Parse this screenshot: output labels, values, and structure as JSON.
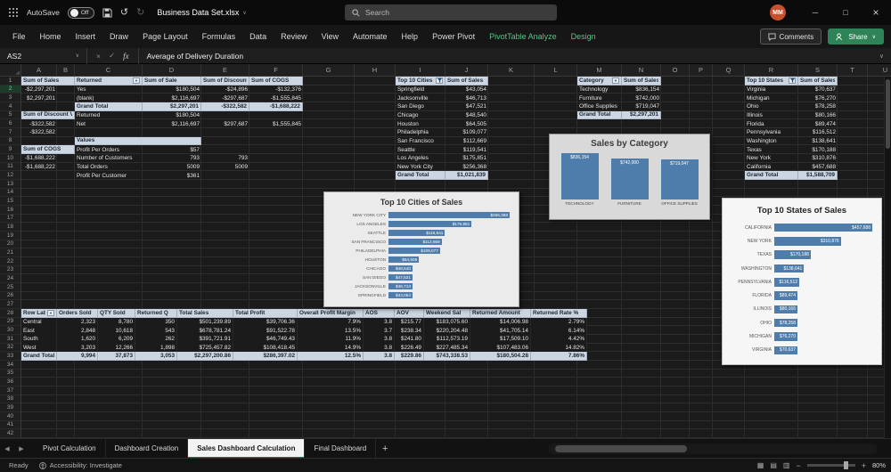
{
  "titlebar": {
    "autosave_label": "AutoSave",
    "autosave_state": "Off",
    "filename": "Business Data Set.xlsx",
    "search_placeholder": "Search",
    "avatar_initials": "MM"
  },
  "ribbon": {
    "tabs": [
      {
        "label": "File"
      },
      {
        "label": "Home"
      },
      {
        "label": "Insert"
      },
      {
        "label": "Draw"
      },
      {
        "label": "Page Layout"
      },
      {
        "label": "Formulas"
      },
      {
        "label": "Data"
      },
      {
        "label": "Review"
      },
      {
        "label": "View"
      },
      {
        "label": "Automate"
      },
      {
        "label": "Help"
      },
      {
        "label": "Power Pivot"
      },
      {
        "label": "PivotTable Analyze",
        "accent": true
      },
      {
        "label": "Design",
        "accent": true
      }
    ],
    "comments_label": "Comments",
    "share_label": "Share"
  },
  "formula_bar": {
    "name_box": "AS2",
    "fx_label": "fx",
    "formula": "Average of Delivery Duration"
  },
  "sheet": {
    "row_count": 42,
    "active_row": 2,
    "blocks": [
      {
        "name": "sales-summary-pivot",
        "col": "A",
        "row": 1,
        "widths": [
          40,
          20
        ],
        "aligns": [
          "r",
          "r"
        ],
        "rows": [
          {
            "r": 1,
            "cls": "hdr",
            "spans": [
              2
            ],
            "cells": [
              "Sum of Sales"
            ]
          },
          {
            "r": 2,
            "cells": [
              "-$2,297,201"
            ]
          },
          {
            "r": 3,
            "cells": [
              "$2,297,201"
            ]
          },
          {
            "r": 5,
            "cls": "hdr",
            "spans": [
              2
            ],
            "cells": [
              "Sum of Discount Value"
            ]
          },
          {
            "r": 6,
            "cells": [
              "-$322,582"
            ]
          },
          {
            "r": 7,
            "cells": [
              "-$322,582"
            ]
          },
          {
            "r": 9,
            "cls": "hdr",
            "spans": [
              2
            ],
            "cells": [
              "Sum of COGS"
            ]
          },
          {
            "r": 10,
            "cells": [
              "-$1,688,222"
            ]
          },
          {
            "r": 11,
            "cells": [
              "-$1,688,222"
            ]
          }
        ]
      },
      {
        "name": "returned-pivot",
        "col": "C",
        "row": 1,
        "widths": [
          76,
          66,
          54,
          60
        ],
        "aligns": [
          "l",
          "r",
          "r",
          "r"
        ],
        "rows": [
          {
            "r": 1,
            "cls": "hdr",
            "icons": {
              "0": "dd"
            },
            "cells": [
              "Returned",
              "Sum of Sale",
              "Sum of Discount Value",
              "Sum of COGS"
            ]
          },
          {
            "r": 2,
            "cells": [
              "Yes",
              "$180,504",
              "-$24,896",
              "-$132,376"
            ]
          },
          {
            "r": 3,
            "cells": [
              "(blank)",
              "$2,116,697",
              "-$297,687",
              "-$1,555,845"
            ]
          },
          {
            "r": 4,
            "cls": "tot",
            "cells": [
              "Grand Total",
              "$2,297,201",
              "-$322,582",
              "-$1,688,222"
            ]
          },
          {
            "r": 5,
            "cells": [
              "Returned",
              "$180,504",
              "",
              ""
            ]
          },
          {
            "r": 6,
            "cells": [
              "Net",
              "$2,116,697",
              "$297,687",
              "$1,555,845"
            ]
          }
        ]
      },
      {
        "name": "values-block",
        "col": "C",
        "row": 8,
        "widths": [
          76,
          66,
          54
        ],
        "aligns": [
          "l",
          "r",
          "r"
        ],
        "rows": [
          {
            "r": 8,
            "cls": "hdr",
            "spans": [
              2
            ],
            "cells": [
              "Values"
            ]
          },
          {
            "r": 9,
            "cells": [
              "Profit Per Orders",
              "$57",
              ""
            ]
          },
          {
            "r": 10,
            "cells": [
              "Number of Customers",
              "793",
              "793"
            ]
          },
          {
            "r": 11,
            "cells": [
              "Total Orders",
              "5009",
              "5009"
            ]
          },
          {
            "r": 12,
            "cells": [
              "Profit Per Customer",
              "$361",
              ""
            ]
          }
        ]
      },
      {
        "name": "top-cities-pivot",
        "col": "I",
        "row": 1,
        "widths": [
          56,
          48
        ],
        "aligns": [
          "l",
          "r"
        ],
        "rows": [
          {
            "r": 1,
            "cls": "hdr",
            "icons": {
              "0": "fl"
            },
            "cells": [
              "Top 10 Cities",
              "Sum of Sales"
            ]
          },
          {
            "r": 2,
            "cells": [
              "Springfield",
              "$43,054"
            ]
          },
          {
            "r": 3,
            "cells": [
              "Jacksonville",
              "$46,713"
            ]
          },
          {
            "r": 4,
            "cells": [
              "San Diego",
              "$47,521"
            ]
          },
          {
            "r": 5,
            "cells": [
              "Chicago",
              "$48,540"
            ]
          },
          {
            "r": 6,
            "cells": [
              "Houston",
              "$64,505"
            ]
          },
          {
            "r": 7,
            "cells": [
              "Philadelphia",
              "$109,077"
            ]
          },
          {
            "r": 8,
            "cells": [
              "San Francisco",
              "$112,669"
            ]
          },
          {
            "r": 9,
            "cells": [
              "Seattle",
              "$119,541"
            ]
          },
          {
            "r": 10,
            "cells": [
              "Los Angeles",
              "$175,851"
            ]
          },
          {
            "r": 11,
            "cells": [
              "New York City",
              "$256,368"
            ]
          },
          {
            "r": 12,
            "cls": "tot",
            "cells": [
              "Grand Total",
              "$1,021,839"
            ]
          }
        ]
      },
      {
        "name": "category-pivot",
        "col": "M",
        "row": 1,
        "widths": [
          50,
          44
        ],
        "aligns": [
          "l",
          "r"
        ],
        "rows": [
          {
            "r": 1,
            "cls": "hdr",
            "icons": {
              "0": "dd"
            },
            "cells": [
              "Category",
              "Sum of Sales"
            ]
          },
          {
            "r": 2,
            "cells": [
              "Technology",
              "$836,154"
            ]
          },
          {
            "r": 3,
            "cells": [
              "Furniture",
              "$742,000"
            ]
          },
          {
            "r": 4,
            "cells": [
              "Office Supplies",
              "$719,047"
            ]
          },
          {
            "r": 5,
            "cls": "tot",
            "cells": [
              "Grand Total",
              "$2,297,201"
            ]
          }
        ]
      },
      {
        "name": "top-states-pivot",
        "col": "R",
        "row": 1,
        "widths": [
          60,
          44
        ],
        "aligns": [
          "l",
          "r"
        ],
        "rows": [
          {
            "r": 1,
            "cls": "hdr",
            "icons": {
              "0": "fl"
            },
            "cells": [
              "Top 10 States",
              "Sum of Sales"
            ]
          },
          {
            "r": 2,
            "cells": [
              "Virginia",
              "$70,637"
            ]
          },
          {
            "r": 3,
            "cells": [
              "Michigan",
              "$76,270"
            ]
          },
          {
            "r": 4,
            "cells": [
              "Ohio",
              "$78,258"
            ]
          },
          {
            "r": 5,
            "cells": [
              "Illinois",
              "$80,166"
            ]
          },
          {
            "r": 6,
            "cells": [
              "Florida",
              "$89,474"
            ]
          },
          {
            "r": 7,
            "cells": [
              "Pennsylvania",
              "$116,512"
            ]
          },
          {
            "r": 8,
            "cells": [
              "Washington",
              "$138,641"
            ]
          },
          {
            "r": 9,
            "cells": [
              "Texas",
              "$170,188"
            ]
          },
          {
            "r": 10,
            "cells": [
              "New York",
              "$310,876"
            ]
          },
          {
            "r": 11,
            "cells": [
              "California",
              "$457,688"
            ]
          },
          {
            "r": 12,
            "cls": "tot",
            "cells": [
              "Grand Total",
              "$1,588,709"
            ]
          }
        ]
      },
      {
        "name": "region-summary-table",
        "col": "A",
        "row": 28,
        "opaque": true,
        "widths": [
          40,
          46,
          42,
          47,
          63,
          72,
          74,
          35,
          33,
          52,
          68,
          63
        ],
        "aligns": [
          "l",
          "r",
          "r",
          "r",
          "r",
          "r",
          "r",
          "r",
          "r",
          "r",
          "r",
          "r"
        ],
        "rows": [
          {
            "r": 28,
            "cls": "hdr",
            "icons": {
              "0": "dd"
            },
            "cells": [
              "Row Label",
              "Orders Sold",
              "QTY Sold",
              "Returned Q",
              "Total Sales",
              "Total Profit",
              "Overall Profit Margin",
              "AOS",
              "AOV",
              "Weekend Sal",
              "Returned Amount",
              "Returned Rate %"
            ]
          },
          {
            "r": 29,
            "cells": [
              "Central",
              "2,323",
              "8,780",
              "350",
              "$501,239.89",
              "$39,706.36",
              "7.9%",
              "3.8",
              "$215.77",
              "$183,075.60",
              "$14,006.98",
              "2.79%"
            ]
          },
          {
            "r": 30,
            "cells": [
              "East",
              "2,848",
              "10,618",
              "543",
              "$678,781.24",
              "$91,522.78",
              "13.5%",
              "3.7",
              "$238.34",
              "$220,204.48",
              "$41,705.14",
              "6.14%"
            ]
          },
          {
            "r": 31,
            "cells": [
              "South",
              "1,620",
              "6,209",
              "262",
              "$391,721.91",
              "$46,749.43",
              "11.9%",
              "3.8",
              "$241.80",
              "$112,573.19",
              "$17,509.10",
              "4.42%"
            ]
          },
          {
            "r": 32,
            "cells": [
              "West",
              "3,203",
              "12,266",
              "1,898",
              "$725,457.82",
              "$108,418.45",
              "14.9%",
              "3.8",
              "$226.49",
              "$227,485.34",
              "$107,483.06",
              "14.82%"
            ]
          },
          {
            "r": 33,
            "cls": "tot",
            "cells": [
              "Grand Total",
              "9,994",
              "37,873",
              "3,053",
              "$2,297,200.86",
              "$286,397.02",
              "12.5%",
              "3.8",
              "$229.86",
              "$743,338.53",
              "$180,504.28",
              "7.86%"
            ]
          }
        ]
      }
    ]
  },
  "charts": [
    {
      "id": "chart-category",
      "type": "column",
      "title": "Sales by Category",
      "categories": [
        "TECHNOLOGY",
        "FURNITURE",
        "OFFICE SUPPLIES"
      ],
      "values": [
        836154,
        742000,
        719047
      ],
      "labels": [
        "$836,154",
        "$742,000",
        "$719,047"
      ]
    },
    {
      "id": "chart-cities",
      "type": "bar",
      "title": "Top 10 Cities of Sales",
      "categories": [
        "NEW YORK CITY",
        "LOS ANGELES",
        "SEATTLE",
        "SAN FRANCISCO",
        "PHILADELPHIA",
        "HOUSTON",
        "CHICAGO",
        "SAN DIEGO",
        "JACKSONVILLE",
        "SPRINGFIELD"
      ],
      "values": [
        256368,
        175851,
        119541,
        112669,
        109077,
        64505,
        48540,
        47521,
        46713,
        43054
      ],
      "labels": [
        "$256,368",
        "$175,851",
        "$119,541",
        "$112,669",
        "$109,077",
        "$64,505",
        "$48,540",
        "$47,521",
        "$46,713",
        "$43,054"
      ]
    },
    {
      "id": "chart-states",
      "type": "bar",
      "title": "Top 10 States of Sales",
      "categories": [
        "CALIFORNIA",
        "NEW YORK",
        "TEXAS",
        "WASHINGTON",
        "PENNSYLVANIA",
        "FLORIDA",
        "ILLINOIS",
        "OHIO",
        "MICHIGAN",
        "VIRGINIA"
      ],
      "values": [
        457688,
        310876,
        170188,
        138641,
        116512,
        89474,
        80166,
        78258,
        76270,
        70637
      ],
      "labels": [
        "$457,688",
        "$310,876",
        "$170,188",
        "$138,641",
        "$116,512",
        "$89,474",
        "$80,166",
        "$78,258",
        "$76,270",
        "$70,637"
      ]
    }
  ],
  "sheet_tabs": {
    "tabs": [
      {
        "label": "Pivot Calculation"
      },
      {
        "label": "Dashboard Creation"
      },
      {
        "label": "Sales Dashboard Calculation",
        "active": true
      },
      {
        "label": "Final Dashboard"
      }
    ]
  },
  "status_bar": {
    "ready": "Ready",
    "accessibility": "Accessibility: Investigate",
    "zoom": "80%"
  },
  "colors": {
    "bar_blue": "#4f7dab",
    "pivot_fill": "#cbd6e2",
    "accent_green": "#0e7a41",
    "avatar_orange": "#c7502e"
  }
}
